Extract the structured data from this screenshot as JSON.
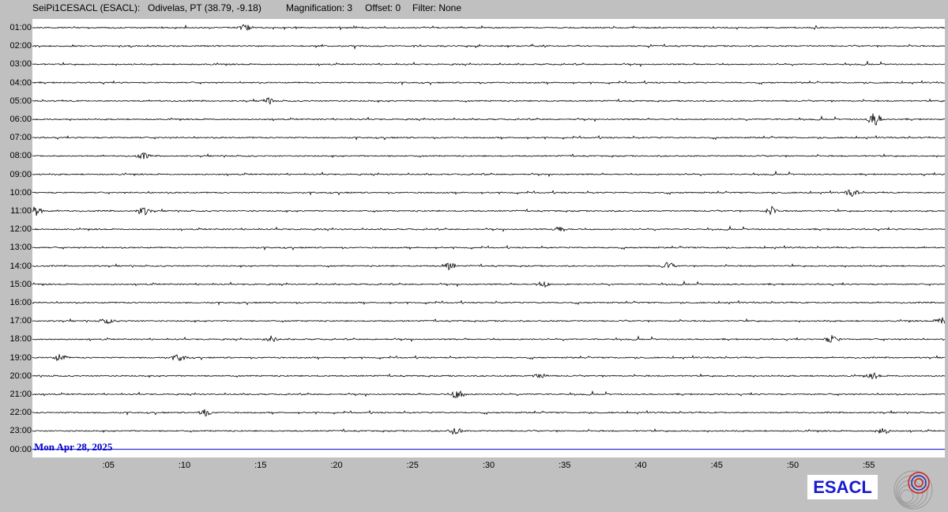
{
  "header": {
    "station": "SeiPi1CESACL (ESACL):",
    "location": "Odivelas, PT (38.79, -9.18)",
    "magnification": "Magnification: 3",
    "offset": "Offset: 0",
    "filter": "Filter: None"
  },
  "hours": [
    "01:00",
    "02:00",
    "03:00",
    "04:00",
    "05:00",
    "06:00",
    "07:00",
    "08:00",
    "09:00",
    "10:00",
    "11:00",
    "12:00",
    "13:00",
    "14:00",
    "15:00",
    "16:00",
    "17:00",
    "18:00",
    "19:00",
    "20:00",
    "21:00",
    "22:00",
    "23:00",
    "00:00"
  ],
  "minute_ticks": [
    ":05",
    ":10",
    ":15",
    ":20",
    ":25",
    ":30",
    ":35",
    ":40",
    ":45",
    ":50",
    ":55"
  ],
  "date_label": "Mon Apr 28, 2025",
  "logo_text": "ESACL",
  "icon": "seismograph-logo-icon",
  "colors": {
    "trace": "#000000",
    "current_line": "#0000cc",
    "background": "#c0c0c0",
    "plot": "#ffffff"
  },
  "events": [
    {
      "hour": "01:00",
      "minute": 14.0,
      "amp": 0.5
    },
    {
      "hour": "05:00",
      "minute": 15.5,
      "amp": 0.4
    },
    {
      "hour": "06:00",
      "minute": 55.4,
      "amp": 1.0
    },
    {
      "hour": "08:00",
      "minute": 7.3,
      "amp": 0.4
    },
    {
      "hour": "10:00",
      "minute": 53.9,
      "amp": 0.5
    },
    {
      "hour": "11:00",
      "minute": 0.2,
      "amp": 0.7
    },
    {
      "hour": "11:00",
      "minute": 7.3,
      "amp": 0.6
    },
    {
      "hour": "11:00",
      "minute": 48.6,
      "amp": 0.6
    },
    {
      "hour": "12:00",
      "minute": 34.7,
      "amp": 0.4
    },
    {
      "hour": "14:00",
      "minute": 27.4,
      "amp": 0.5
    },
    {
      "hour": "14:00",
      "minute": 41.8,
      "amp": 0.5
    },
    {
      "hour": "15:00",
      "minute": 33.6,
      "amp": 0.4
    },
    {
      "hour": "17:00",
      "minute": 4.9,
      "amp": 0.4
    },
    {
      "hour": "17:00",
      "minute": 59.8,
      "amp": 0.5
    },
    {
      "hour": "18:00",
      "minute": 15.7,
      "amp": 0.4
    },
    {
      "hour": "18:00",
      "minute": 52.6,
      "amp": 0.6
    },
    {
      "hour": "19:00",
      "minute": 1.8,
      "amp": 0.5
    },
    {
      "hour": "19:00",
      "minute": 9.7,
      "amp": 0.5
    },
    {
      "hour": "20:00",
      "minute": 33.4,
      "amp": 0.4
    },
    {
      "hour": "20:00",
      "minute": 55.3,
      "amp": 0.4
    },
    {
      "hour": "21:00",
      "minute": 28.0,
      "amp": 0.8
    },
    {
      "hour": "22:00",
      "minute": 11.3,
      "amp": 0.5
    },
    {
      "hour": "23:00",
      "minute": 27.8,
      "amp": 0.5
    },
    {
      "hour": "23:00",
      "minute": 55.9,
      "amp": 0.5
    }
  ]
}
